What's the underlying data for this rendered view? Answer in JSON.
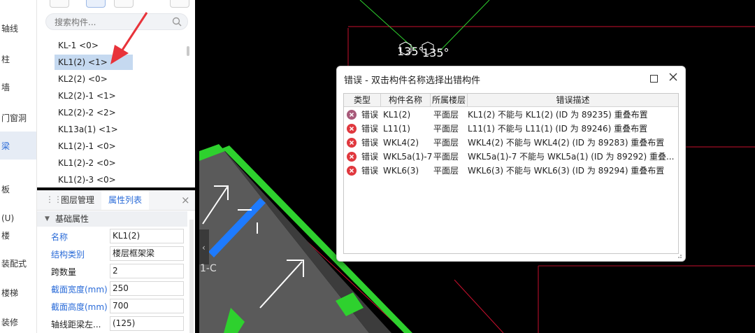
{
  "left_nav": {
    "items": [
      {
        "label": "轴线",
        "active": false
      },
      {
        "label": "柱",
        "active": false
      },
      {
        "label": "墙",
        "active": false
      },
      {
        "label": "门窗洞",
        "active": false
      },
      {
        "label": "梁",
        "active": true
      },
      {
        "label": "板",
        "active": false
      },
      {
        "label": "(U)",
        "active": false
      },
      {
        "label": "楼",
        "active": false
      },
      {
        "label": "装配式",
        "active": false
      },
      {
        "label": "楼梯",
        "active": false
      },
      {
        "label": "装修",
        "active": false
      }
    ]
  },
  "component_panel": {
    "search_placeholder": "搜索构件...",
    "items": [
      {
        "label": "KL-1 <0>",
        "selected": false
      },
      {
        "label": "KL1(2) <1>",
        "selected": true
      },
      {
        "label": "KL2(2) <0>",
        "selected": false
      },
      {
        "label": "KL2(2)-1 <1>",
        "selected": false
      },
      {
        "label": "KL2(2)-2 <2>",
        "selected": false
      },
      {
        "label": "KL13a(1) <1>",
        "selected": false
      },
      {
        "label": "KL1(2)-1 <0>",
        "selected": false
      },
      {
        "label": "KL1(2)-2 <0>",
        "selected": false
      },
      {
        "label": "KL1(2)-3 <0>",
        "selected": false
      }
    ]
  },
  "property_panel": {
    "tabs": [
      "图层管理",
      "属性列表"
    ],
    "active_tab": "属性列表",
    "group": "基础属性",
    "rows": [
      {
        "label": "名称",
        "value": "KL1(2)",
        "blue": true
      },
      {
        "label": "结构类别",
        "value": "楼层框架梁",
        "blue": true
      },
      {
        "label": "跨数量",
        "value": "2",
        "blue": false
      },
      {
        "label": "截面宽度(mm)",
        "value": "250",
        "blue": true
      },
      {
        "label": "截面高度(mm)",
        "value": "700",
        "blue": true
      },
      {
        "label": "轴线距梁左...",
        "value": "(125)",
        "blue": false
      }
    ]
  },
  "canvas": {
    "angle_labels": [
      "135°",
      "135°"
    ],
    "axis_label": "1-C",
    "colors": {
      "background": "#000000",
      "grid": "#c8102e",
      "green": "#2ed12e",
      "slab": "#5a5a5a",
      "beam": "#1e7bff",
      "arrow": "#ffffff"
    }
  },
  "dialog": {
    "title": "错误 - 双击构件名称选择出错构件",
    "columns": [
      "类型",
      "构件名称",
      "所属楼层",
      "错误描述"
    ],
    "rows": [
      {
        "type": "错误",
        "name": "KL1(2)",
        "floor": "平面层",
        "desc": "KL1(2) 不能与 KL1(2) (ID 为 89235) 重叠布置",
        "icon_color": "#a85a7a"
      },
      {
        "type": "错误",
        "name": "L11(1)",
        "floor": "平面层",
        "desc": "L11(1) 不能与 L11(1) (ID 为 89246) 重叠布置",
        "icon_color": "#e0383e"
      },
      {
        "type": "错误",
        "name": "WKL4(2)",
        "floor": "平面层",
        "desc": "WKL4(2) 不能与 WKL4(2) (ID 为 89283) 重叠布置",
        "icon_color": "#e0383e"
      },
      {
        "type": "错误",
        "name": "WKL5a(1)-7",
        "floor": "平面层",
        "desc": "WKL5a(1)-7 不能与 WKL5a(1) (ID 为 89292) 重叠...",
        "icon_color": "#e0383e"
      },
      {
        "type": "错误",
        "name": "WKL6(3)",
        "floor": "平面层",
        "desc": "WKL6(3) 不能与 WKL6(3) (ID 为 89294) 重叠布置",
        "icon_color": "#e0383e"
      }
    ]
  }
}
